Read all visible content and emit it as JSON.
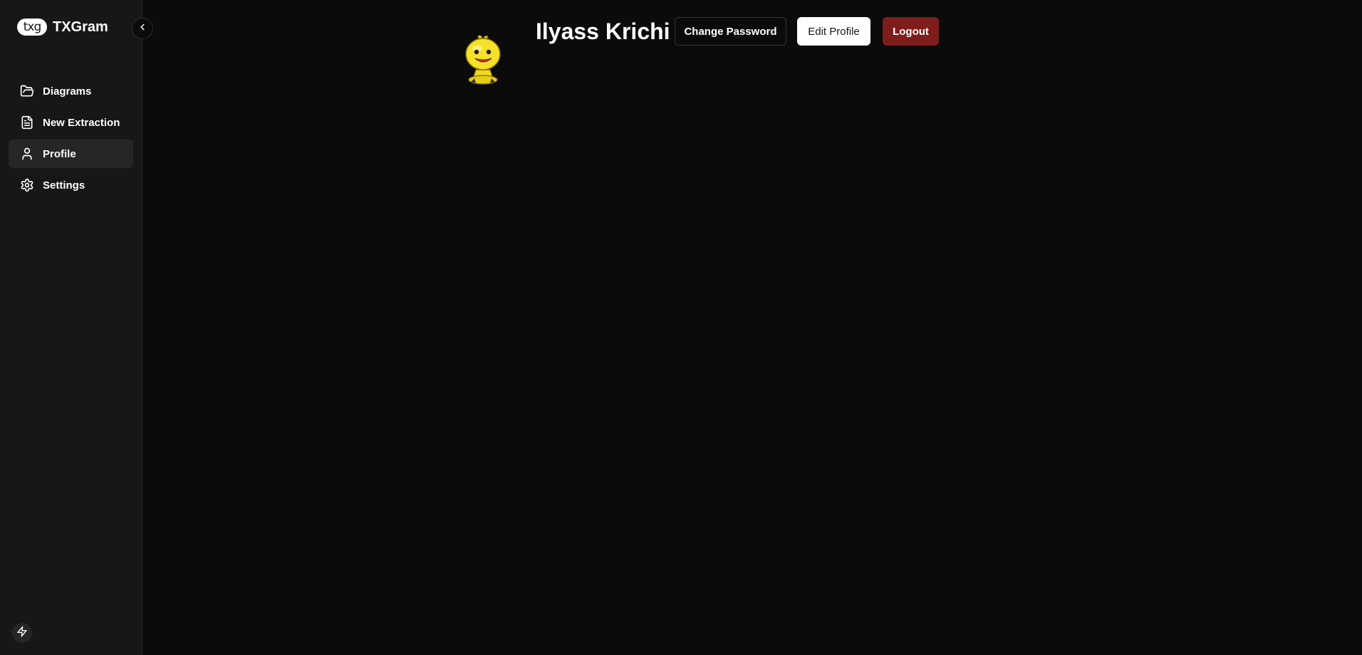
{
  "brand": {
    "logo_text": "txg",
    "name": "TXGram"
  },
  "sidebar": {
    "collapse_icon": "chevron-left-icon",
    "items": [
      {
        "label": "Diagrams",
        "icon": "folder-open-icon",
        "active": false
      },
      {
        "label": "New Extraction",
        "icon": "file-text-icon",
        "active": false
      },
      {
        "label": "Profile",
        "icon": "user-icon",
        "active": true
      },
      {
        "label": "Settings",
        "icon": "gear-icon",
        "active": false
      }
    ],
    "footer_icon": "bolt-icon"
  },
  "profile": {
    "name": "Ilyass Krichi",
    "avatar_icon": "avatar-character-icon",
    "buttons": {
      "change_password": "Change Password",
      "edit_profile": "Edit Profile",
      "logout": "Logout"
    }
  },
  "colors": {
    "background": "#0b0b0b",
    "sidebar": "#171717",
    "active_item": "#262626",
    "logout": "#7f1d1d",
    "avatar": "#f5e02a"
  }
}
